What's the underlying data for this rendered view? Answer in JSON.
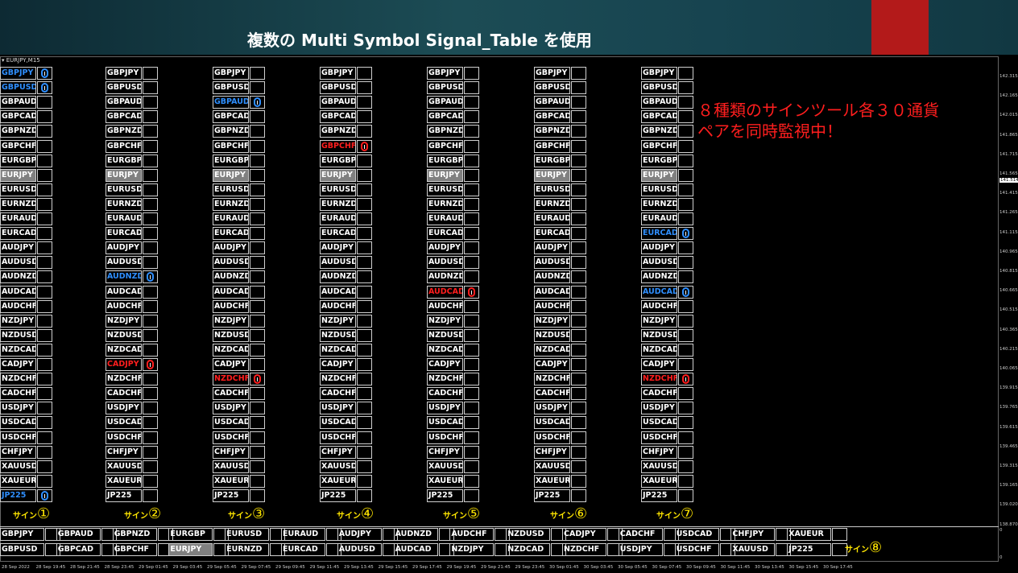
{
  "header": {
    "title": "複数の Multi Symbol Signal_Table を使用"
  },
  "chart": {
    "label": "▾ EURJPY,M15",
    "prices": [
      "142.315",
      "142.165",
      "142.015",
      "141.865",
      "141.715",
      "141.565",
      "141.415",
      "141.265",
      "141.115",
      "140.965",
      "140.815",
      "140.665",
      "140.515",
      "140.365",
      "140.215",
      "140.065",
      "139.915",
      "139.765",
      "139.615",
      "139.465",
      "139.315",
      "139.165",
      "139.020",
      "138.870",
      "0",
      "0"
    ],
    "current_price": "141.514",
    "times": [
      "28 Sep 2022",
      "28 Sep 19:45",
      "28 Sep 21:45",
      "28 Sep 23:45",
      "29 Sep 01:45",
      "29 Sep 03:45",
      "29 Sep 05:45",
      "29 Sep 07:45",
      "29 Sep 09:45",
      "29 Sep 11:45",
      "29 Sep 13:45",
      "29 Sep 15:45",
      "29 Sep 17:45",
      "29 Sep 19:45",
      "29 Sep 21:45",
      "29 Sep 23:45",
      "30 Sep 01:45",
      "30 Sep 03:45",
      "30 Sep 05:45",
      "30 Sep 07:45",
      "30 Sep 09:45",
      "30 Sep 11:45",
      "30 Sep 13:45",
      "30 Sep 15:45",
      "30 Sep 17:45"
    ]
  },
  "annotation": {
    "line1": "８種類のサインツール各３０通貨",
    "line2": "ペアを同時監視中！"
  },
  "symbols": [
    "GBPJPY",
    "GBPUSD",
    "GBPAUD",
    "GBPCAD",
    "GBPNZD",
    "GBPCHF",
    "EURGBP",
    "EURJPY",
    "EURUSD",
    "EURNZD",
    "EURAUD",
    "EURCAD",
    "AUDJPY",
    "AUDUSD",
    "AUDNZD",
    "AUDCAD",
    "AUDCHF",
    "NZDJPY",
    "NZDUSD",
    "NZDCAD",
    "CADJPY",
    "NZDCHF",
    "CADCHF",
    "USDJPY",
    "USDCAD",
    "USDCHF",
    "CHFJPY",
    "XAUUSD",
    "XAUEUR",
    "JP225"
  ],
  "colors": {
    "blue": "#2f8fff",
    "red": "#ff1e1e",
    "highlight": "#808080",
    "label": "#ffe600"
  },
  "columns": [
    {
      "label_text": "サイン",
      "label_num": "①",
      "symbols": [
        "GBPJPY",
        "GBPUSD",
        "GBPAUD",
        "GBPCAD",
        "GBPNZD",
        "GBPCHF",
        "EURGBP",
        "EURJPY",
        "EURUSD",
        "EURNZD",
        "EURAUD",
        "EURCAD",
        "AUDJPY",
        "AUDUSD",
        "AUDNZD",
        "AUDCAD",
        "AUDCHF",
        "NZDJPY",
        "NZDUSD",
        "NZDCAD",
        "CADJPY",
        "NZDCHF",
        "CADCHF",
        "USDJPY",
        "USDCAD",
        "USDCHF",
        "CHFJPY",
        "XAUUSD",
        "XAUEUR",
        "JP225"
      ],
      "signals": {
        "0": "down",
        "1": "down",
        "29": "down"
      }
    },
    {
      "label_text": "サイン",
      "label_num": "②",
      "symbols": [
        "GBPJPY",
        "GBPUSD",
        "GBPAUD",
        "GBPCAD",
        "GBPNZD",
        "GBPCHF",
        "EURGBP",
        "EURJPY",
        "EURUSD",
        "EURNZD",
        "EURAUD",
        "EURCAD",
        "AUDJPY",
        "AUDUSD",
        "AUDNZD",
        "AUDCAD",
        "AUDCHF",
        "NZDJPY",
        "NZDUSD",
        "NZDCAD",
        "CADJPY",
        "NZDCHF",
        "CADCHF",
        "USDJPY",
        "USDCAD",
        "USDCHF",
        "CHFJPY",
        "XAUUSD",
        "XAUEUR",
        "JP225"
      ],
      "signals": {
        "14": "down",
        "20": "up"
      }
    },
    {
      "label_text": "サイン",
      "label_num": "③",
      "symbols": [
        "GBPJPY",
        "GBPUSD",
        "GBPAUD",
        "GBPCAD",
        "GBPNZD",
        "GBPCHF",
        "EURGBP",
        "EURJPY",
        "EURUSD",
        "EURNZD",
        "EURAUD",
        "EURCAD",
        "AUDJPY",
        "AUDUSD",
        "AUDNZD",
        "AUDCAD",
        "AUDCHF",
        "NZDJPY",
        "NZDUSD",
        "NZDCAD",
        "CADJPY",
        "NZDCHF",
        "CADCHF",
        "USDJPY",
        "USDCAD",
        "USDCHF",
        "CHFJPY",
        "XAUUSD",
        "XAUEUR",
        "JP225"
      ],
      "signals": {
        "2": "down",
        "21": "up"
      }
    },
    {
      "label_text": "サイン",
      "label_num": "④",
      "symbols": [
        "GBPJPY",
        "GBPUSD",
        "GBPAUD",
        "GBPCAD",
        "GBPNZD",
        "GBPCHF",
        "EURGBP",
        "EURJPY",
        "EURUSD",
        "EURNZD",
        "EURAUD",
        "EURCAD",
        "AUDJPY",
        "AUDUSD",
        "AUDNZD",
        "AUDCAD",
        "AUDCHF",
        "NZDJPY",
        "NZDUSD",
        "NZDCAD",
        "CADJPY",
        "NZDCHF",
        "CADCHF",
        "USDJPY",
        "USDCAD",
        "USDCHF",
        "CHFJPY",
        "XAUUSD",
        "XAUEUR",
        "JP225"
      ],
      "signals": {
        "5": "up"
      }
    },
    {
      "label_text": "サイン",
      "label_num": "⑤",
      "symbols": [
        "GBPJPY",
        "GBPUSD",
        "GBPAUD",
        "GBPCAD",
        "GBPNZD",
        "GBPCHF",
        "EURGBP",
        "EURJPY",
        "EURUSD",
        "EURNZD",
        "EURAUD",
        "EURCAD",
        "AUDJPY",
        "AUDUSD",
        "AUDNZD",
        "AUDCAD",
        "AUDCHF",
        "NZDJPY",
        "NZDUSD",
        "NZDCAD",
        "CADJPY",
        "NZDCHF",
        "CADCHF",
        "USDJPY",
        "USDCAD",
        "USDCHF",
        "CHFJPY",
        "XAUUSD",
        "XAUEUR",
        "JP225"
      ],
      "signals": {
        "15": "up"
      }
    },
    {
      "label_text": "サイン",
      "label_num": "⑥",
      "symbols": [
        "GBPJPY",
        "GBPUSD",
        "GBPAUD",
        "GBPCAD",
        "GBPNZD",
        "GBPCHF",
        "EURGBP",
        "EURJPY",
        "EURUSD",
        "EURNZD",
        "EURAUD",
        "EURCAD",
        "AUDJPY",
        "AUDUSD",
        "AUDNZD",
        "AUDCAD",
        "AUDCHF",
        "NZDJPY",
        "NZDUSD",
        "NZDCAD",
        "CADJPY",
        "NZDCHF",
        "CADCHF",
        "USDJPY",
        "USDCAD",
        "USDCHF",
        "CHFJPY",
        "XAUUSD",
        "XAUEUR",
        "JP225"
      ],
      "signals": {}
    },
    {
      "label_text": "サイン",
      "label_num": "⑦",
      "symbols": [
        "GBPJPY",
        "GBPUSD",
        "GBPAUD",
        "GBPCAD",
        "GBPNZD",
        "GBPCHF",
        "EURGBP",
        "EURJPY",
        "EURUSD",
        "EURNZD",
        "EURAUD",
        "EURCAD",
        "AUDJPY",
        "AUDUSD",
        "AUDNZD",
        "AUDCAD",
        "AUDCHF",
        "NZDJPY",
        "NZDUSD",
        "NZDCAD",
        "CADJPY",
        "NZDCHF",
        "CADCHF",
        "USDJPY",
        "USDCAD",
        "USDCHF",
        "CHFJPY",
        "XAUUSD",
        "XAUEUR",
        "JP225"
      ],
      "signals": {
        "11": "down",
        "15": "down",
        "21": "up"
      }
    }
  ],
  "bottom_table": {
    "label_text": "サイン",
    "label_num": "⑧",
    "row1": [
      "GBPJPY",
      "GBPAUD",
      "GBPNZD",
      "EURGBP",
      "EURUSD",
      "EURAUD",
      "AUDJPY",
      "AUDNZD",
      "AUDCHF",
      "NZDUSD",
      "CADJPY",
      "CADCHF",
      "USDCAD",
      "CHFJPY",
      "XAUEUR"
    ],
    "row2": [
      "GBPUSD",
      "GBPCAD",
      "GBPCHF",
      "EURJPY",
      "EURNZD",
      "EURCAD",
      "AUDUSD",
      "AUDCAD",
      "NZDJPY",
      "NZDCAD",
      "NZDCHF",
      "USDJPY",
      "USDCHF",
      "XAUUSD",
      "JP225"
    ],
    "highlight": "EURJPY"
  }
}
